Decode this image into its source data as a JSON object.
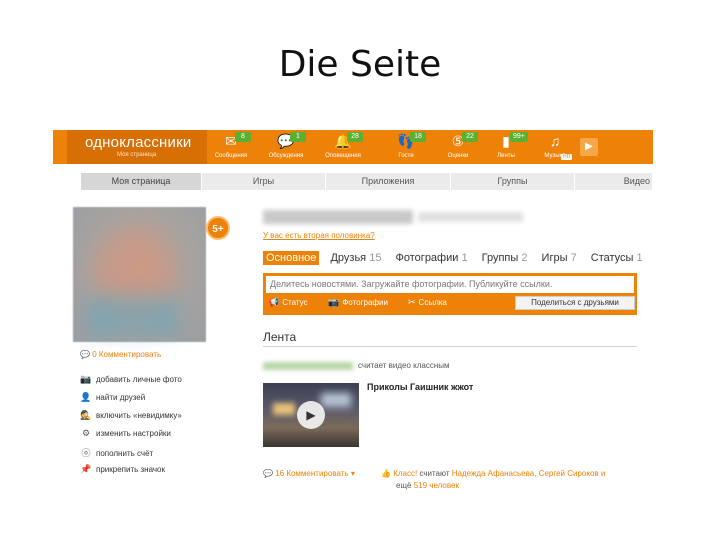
{
  "slide": {
    "title": "Die Seite"
  },
  "header": {
    "logo": "одноклассники",
    "logo_sub": "Моя страница",
    "nav": [
      {
        "label": "Сообщения",
        "badge": "8",
        "icon": "envelope-icon",
        "glyph": "✉"
      },
      {
        "label": "Обсуждения",
        "badge": "1",
        "icon": "chat-bubbles-icon",
        "glyph": "💬"
      },
      {
        "label": "Оповещения",
        "badge": "28",
        "icon": "bell-icon",
        "glyph": "🔔"
      },
      {
        "label": "Гости",
        "badge": "18",
        "icon": "footprints-icon",
        "glyph": "👣"
      },
      {
        "label": "Оценки",
        "badge": "22",
        "icon": "rating-five-icon",
        "glyph": "⑤"
      },
      {
        "label": "Ленты",
        "badge": "99+",
        "icon": "feed-icon",
        "glyph": "▮"
      },
      {
        "label": "Музыка",
        "badge": "",
        "icon": "music-note-icon",
        "glyph": "♫"
      }
    ],
    "music_tag": "HD",
    "play_glyph": "▶"
  },
  "subnav": [
    "Моя страница",
    "Игры",
    "Приложения",
    "Группы",
    "Видео"
  ],
  "profile": {
    "badge_five": "5+",
    "second_half": "У вас есть вторая половинка?",
    "left_comment": "0 Комментировать",
    "left_actions": [
      {
        "label": "добавить личные фото",
        "icon": "camera-icon",
        "glyph": "📷"
      },
      {
        "label": "найти друзей",
        "icon": "friends-icon",
        "glyph": "👤"
      },
      {
        "label": "включить «невидимку»",
        "icon": "incognito-icon",
        "glyph": "🕵"
      },
      {
        "label": "изменить настройки",
        "icon": "gear-icon",
        "glyph": "⚙"
      },
      {
        "label": "пополнить счёт",
        "icon": "coin-icon",
        "glyph": "ⓞ"
      },
      {
        "label": "прикрепить значок",
        "icon": "pin-icon",
        "glyph": "📌"
      }
    ],
    "tabs": [
      {
        "label": "Основное",
        "count": ""
      },
      {
        "label": "Друзья",
        "count": "15"
      },
      {
        "label": "Фотографии",
        "count": "1"
      },
      {
        "label": "Группы",
        "count": "2"
      },
      {
        "label": "Игры",
        "count": "7"
      },
      {
        "label": "Статусы",
        "count": "1"
      }
    ]
  },
  "post": {
    "placeholder": "Делитесь новостями. Загружайте фотографии. Публикуйте ссылки.",
    "actions": [
      {
        "label": "Статус",
        "icon": "megaphone-icon",
        "glyph": "📢"
      },
      {
        "label": "Фотографии",
        "icon": "camera-icon",
        "glyph": "📷"
      },
      {
        "label": "Ссылка",
        "icon": "scissors-link-icon",
        "glyph": "✂"
      }
    ],
    "share_label": "Поделиться с друзьями"
  },
  "feed": {
    "title": "Лента",
    "action_text": "считает видео классным",
    "video_title": "Приколы Гаишник жжот",
    "comment_label": "16 Комментировать",
    "class_prefix": "Класс!",
    "class_text": "считают",
    "class_names": "Надежда Афанасьева, Сергей Сироков и",
    "class_more_prefix": "ещё",
    "class_more": "519 человек"
  }
}
